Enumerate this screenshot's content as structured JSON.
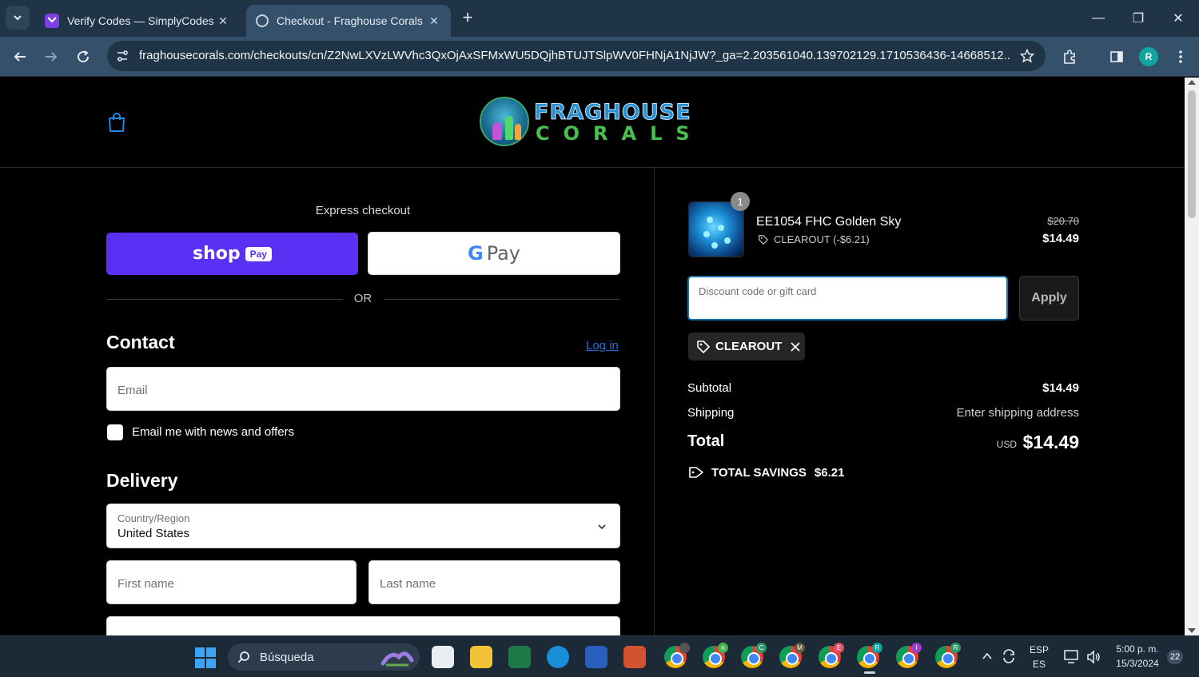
{
  "browser": {
    "tabs": [
      {
        "title": "Verify Codes — SimplyCodes",
        "active": false,
        "icon": "simplycodes-favicon"
      },
      {
        "title": "Checkout - Fraghouse Corals",
        "active": true,
        "icon": "globe-favicon"
      }
    ],
    "url": "fraghousecorals.com/checkouts/cn/Z2NwLXVzLWVhc3QxOjAxSFMxWU5DQjhBTUJTSlpWV0FHNjA1NjJW?_ga=2.203561040.139702129.1710536436-14668512...",
    "profile_initial": "R"
  },
  "site": {
    "logo_line1": "FRAGHOUSE",
    "logo_line2": "CORALS"
  },
  "checkout": {
    "express_label": "Express checkout",
    "shoppay_word": "shop",
    "shoppay_pill": "Pay",
    "gpay_g": "G",
    "gpay_pay": "Pay",
    "or_text": "OR",
    "contact_heading": "Contact",
    "login_link": "Log in",
    "email_placeholder": "Email",
    "newsletter_label": "Email me with news and offers",
    "delivery_heading": "Delivery",
    "country_label": "Country/Region",
    "country_value": "United States",
    "first_name_placeholder": "First name",
    "last_name_placeholder": "Last name"
  },
  "summary": {
    "product": {
      "quantity": "1",
      "name": "EE1054 FHC Golden Sky",
      "discount": "CLEAROUT (-$6.21)",
      "price_original": "$20.70",
      "price_final": "$14.49"
    },
    "discount_placeholder": "Discount code or gift card",
    "apply_label": "Apply",
    "applied_code": "CLEAROUT",
    "subtotal_label": "Subtotal",
    "subtotal_value": "$14.49",
    "shipping_label": "Shipping",
    "shipping_value": "Enter shipping address",
    "total_label": "Total",
    "total_currency": "USD",
    "total_value": "$14.49",
    "savings_label": "TOTAL SAVINGS",
    "savings_value": "$6.21"
  },
  "taskbar": {
    "search_text": "Búsqueda",
    "chrome_badges": [
      "",
      "n",
      "C",
      "M",
      "E",
      "R",
      "I",
      "R"
    ],
    "language": "ESP",
    "language_sub": "ES",
    "time": "5:00 p. m.",
    "date": "15/3/2024",
    "notifications": "22"
  },
  "colors": {
    "shoppay": "#5a31f4",
    "link": "#2a6dd9",
    "focus_border": "#1773b0",
    "browser_tab": "#35506a"
  }
}
